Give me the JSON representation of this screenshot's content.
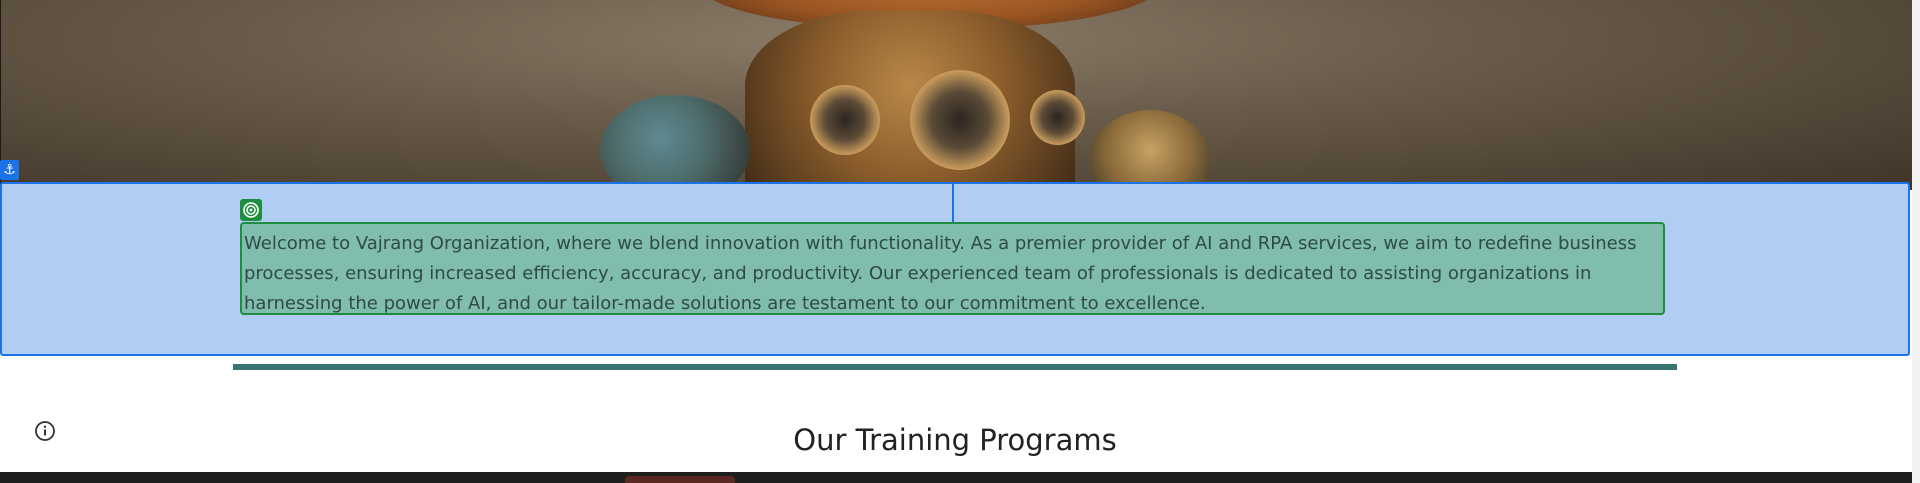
{
  "hero": {
    "image_name": "robot-hero-image"
  },
  "editor": {
    "anchor_icon": "anchor-icon",
    "target_icon": "target-icon",
    "info_icon": "info-icon",
    "selection_color": "#1a73e8",
    "block_color": "#1e8e3e"
  },
  "intro": {
    "paragraph": "Welcome to Vajrang Organization, where we blend innovation with functionality. As a premier provider of AI and RPA services, we aim to redefine business processes, ensuring increased efficiency, accuracy, and productivity. Our experienced team of professionals is dedicated to assisting organizations in harnessing the power of AI, and our tailor-made solutions are testament to our commitment to excellence."
  },
  "training": {
    "title": "Our Training Programs"
  }
}
